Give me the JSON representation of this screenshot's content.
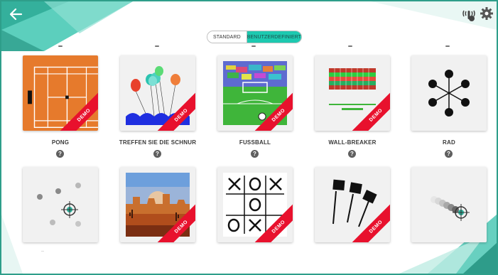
{
  "colors": {
    "accent": "#1dc9b0",
    "frame": "#2e9e8a",
    "demo_ribbon": "#e8112d",
    "help_icon": "#5f5f5f"
  },
  "header": {
    "back_icon": "arrow-left-icon",
    "hardware_icon": "touch-signal-icon",
    "settings_icon": "gear-icon"
  },
  "mode_toggle": {
    "options": [
      "STANDARD",
      "BENUTZERDEFINIERT"
    ],
    "selected": "STANDARD"
  },
  "games": [
    {
      "title": "PONG",
      "demo": "DEMO",
      "help": "?",
      "icon": "tennis-court-icon"
    },
    {
      "title": "TREFFEN SIE DIE SCHNUR",
      "demo": "DEMO",
      "help": "?",
      "icon": "balloons-icon"
    },
    {
      "title": "FUSSBALL",
      "demo": "DEMO",
      "help": "?",
      "icon": "soccer-field-icon"
    },
    {
      "title": "WALL-BREAKER",
      "demo": "DEMO",
      "help": "?",
      "icon": "brick-wall-icon"
    },
    {
      "title": "RAD",
      "demo": "",
      "help": "?",
      "icon": "wheel-icon"
    },
    {
      "title": "",
      "demo": "",
      "help": "",
      "icon": "dots-target-icon"
    },
    {
      "title": "",
      "demo": "DEMO",
      "help": "",
      "icon": "desert-landscape-icon"
    },
    {
      "title": "",
      "demo": "DEMO",
      "help": "",
      "icon": "tic-tac-toe-icon"
    },
    {
      "title": "",
      "demo": "DEMO",
      "help": "",
      "icon": "flags-icon"
    },
    {
      "title": "",
      "demo": "",
      "help": "",
      "icon": "motion-trail-target-icon"
    }
  ],
  "footer_text": ".."
}
